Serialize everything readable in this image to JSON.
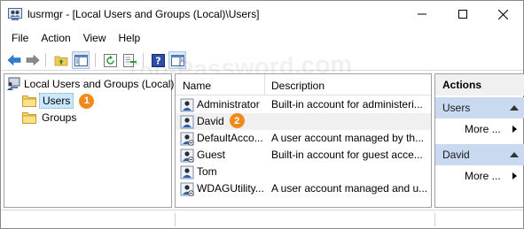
{
  "window": {
    "title": "lusrmgr - [Local Users and Groups (Local)\\Users]"
  },
  "menu": [
    "File",
    "Action",
    "View",
    "Help"
  ],
  "toolbar": {
    "buttons": [
      "back-icon",
      "forward-icon",
      "up-folder-icon",
      "show-hide-tree-icon",
      "refresh-icon",
      "export-list-icon",
      "help-icon",
      "show-hide-action-pane-icon"
    ]
  },
  "tree": {
    "root": "Local Users and Groups (Local)",
    "children": [
      "Users",
      "Groups"
    ],
    "selected_badge": "1"
  },
  "list": {
    "columns": [
      "Name",
      "Description"
    ],
    "rows": [
      {
        "name": "Administrator",
        "description": "Built-in account for administeri..."
      },
      {
        "name": "David",
        "description": ""
      },
      {
        "name": "DefaultAcco...",
        "description": "A user account managed by th..."
      },
      {
        "name": "Guest",
        "description": "Built-in account for guest acce..."
      },
      {
        "name": "Tom",
        "description": ""
      },
      {
        "name": "WDAGUtility...",
        "description": "A user account managed and u..."
      }
    ],
    "david_badge": "2"
  },
  "actions": {
    "title": "Actions",
    "sections": [
      {
        "header": "Users",
        "item": "More ..."
      },
      {
        "header": "David",
        "item": "More ..."
      }
    ]
  },
  "watermark": "Top-Password.com",
  "colors": {
    "badge": "#f08a1c",
    "selection": "#cce8ff",
    "action_header": "#c9daf0"
  }
}
